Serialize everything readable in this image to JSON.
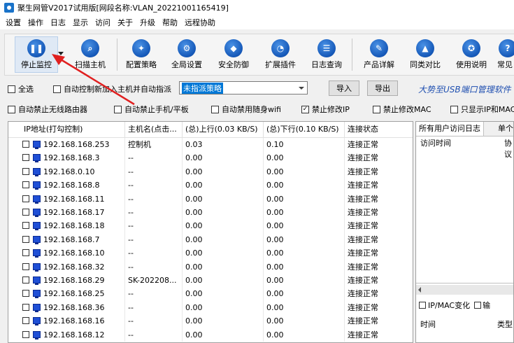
{
  "window": {
    "title": "聚生网管V2017试用版[网段名称:VLAN_20221001165419]"
  },
  "menu": [
    "设置",
    "操作",
    "日志",
    "显示",
    "访问",
    "关于",
    "升级",
    "帮助",
    "远程协助"
  ],
  "toolbar": {
    "buttons": [
      {
        "label": "停止监控",
        "icon": "pause-icon"
      },
      {
        "label": "扫描主机",
        "icon": "magnifier-icon"
      },
      {
        "label": "配置策略",
        "icon": "policy-icon"
      },
      {
        "label": "全局设置",
        "icon": "gear-icon"
      },
      {
        "label": "安全防御",
        "icon": "shield-icon"
      },
      {
        "label": "扩展插件",
        "icon": "plugin-icon"
      },
      {
        "label": "日志查询",
        "icon": "log-icon"
      },
      {
        "label": "产品详解",
        "icon": "product-icon"
      },
      {
        "label": "同类对比",
        "icon": "compare-icon"
      },
      {
        "label": "使用说明",
        "icon": "manual-icon"
      },
      {
        "label": "常见",
        "icon": "faq-icon"
      }
    ]
  },
  "controls": {
    "select_all": "全选",
    "auto_control": "自动控制新加入主机并自动指派",
    "policy_select": "未指派策略",
    "import_btn": "导入",
    "export_btn": "导出",
    "slogan": "大势至USB端口管理软件",
    "opts": [
      {
        "label": "自动禁止无线路由器",
        "checked": false
      },
      {
        "label": "自动禁止手机/平板",
        "checked": false
      },
      {
        "label": "自动禁用随身wifi",
        "checked": false
      },
      {
        "label": "禁止修改IP",
        "checked": true
      },
      {
        "label": "禁止修改MAC",
        "checked": false
      },
      {
        "label": "只显示IP和MAC",
        "checked": false
      }
    ]
  },
  "table": {
    "headers": [
      "IP地址(打勾控制)",
      "主机名(点击...",
      "(总)上行(0.03 KB/S)",
      "(总)下行(0.10 KB/S)",
      "连接状态"
    ],
    "rows": [
      [
        "192.168.168.253",
        "控制机",
        "0.03",
        "0.10",
        "连接正常"
      ],
      [
        "192.168.168.3",
        "--",
        "0.00",
        "0.00",
        "连接正常"
      ],
      [
        "192.168.0.10",
        "--",
        "0.00",
        "0.00",
        "连接正常"
      ],
      [
        "192.168.168.8",
        "--",
        "0.00",
        "0.00",
        "连接正常"
      ],
      [
        "192.168.168.11",
        "--",
        "0.00",
        "0.00",
        "连接正常"
      ],
      [
        "192.168.168.17",
        "--",
        "0.00",
        "0.00",
        "连接正常"
      ],
      [
        "192.168.168.18",
        "--",
        "0.00",
        "0.00",
        "连接正常"
      ],
      [
        "192.168.168.7",
        "--",
        "0.00",
        "0.00",
        "连接正常"
      ],
      [
        "192.168.168.10",
        "--",
        "0.00",
        "0.00",
        "连接正常"
      ],
      [
        "192.168.168.32",
        "--",
        "0.00",
        "0.00",
        "连接正常"
      ],
      [
        "192.168.168.29",
        "SK-202208...",
        "0.00",
        "0.00",
        "连接正常"
      ],
      [
        "192.168.168.25",
        "--",
        "0.00",
        "0.00",
        "连接正常"
      ],
      [
        "192.168.168.36",
        "--",
        "0.00",
        "0.00",
        "连接正常"
      ],
      [
        "192.168.168.16",
        "--",
        "0.00",
        "0.00",
        "连接正常"
      ],
      [
        "192.168.168.12",
        "--",
        "0.00",
        "0.00",
        "连接正常"
      ]
    ]
  },
  "right_panel": {
    "tabs": [
      "所有用户访问日志",
      "单个"
    ],
    "col1": "访问时间",
    "col2": "协议",
    "section2_check": "IP/MAC变化",
    "section2_extra": "输",
    "col3": "时间",
    "col4": "类型"
  },
  "annotation_color": "#e02020"
}
